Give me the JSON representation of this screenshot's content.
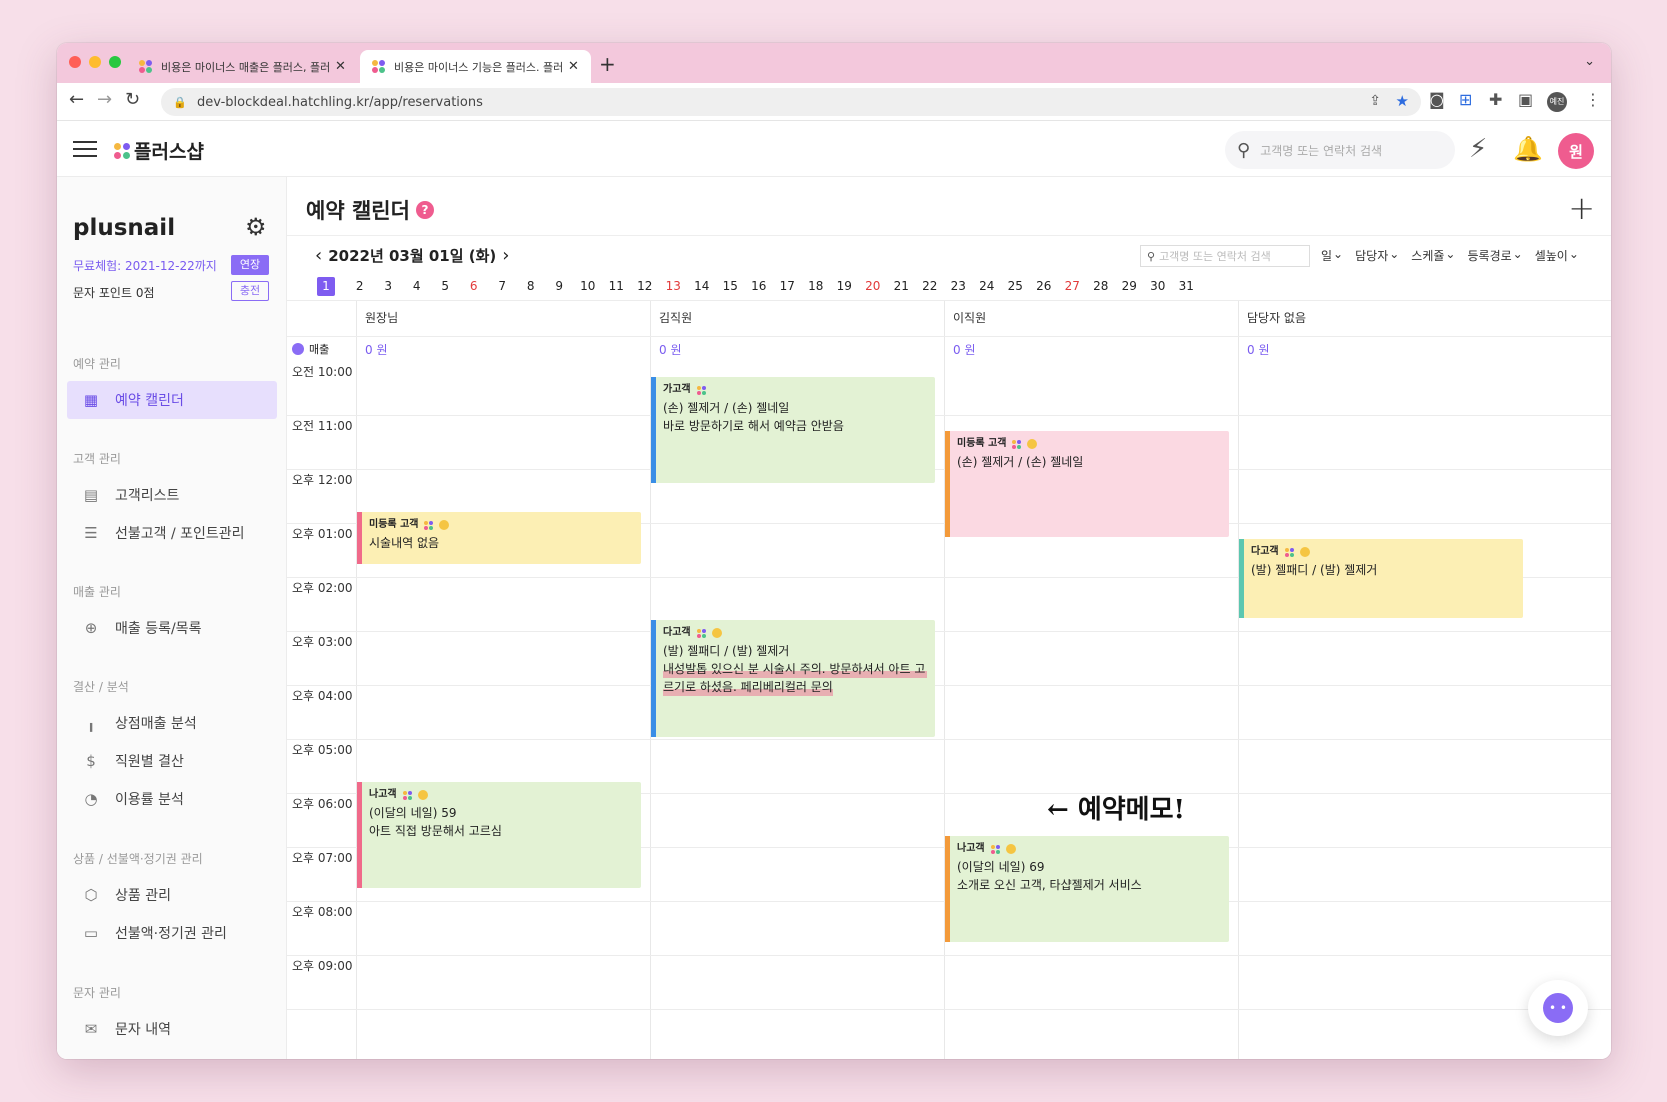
{
  "browser": {
    "tabs": [
      {
        "title": "비용은 마이너스 매출은 플러스, 플러스샵"
      },
      {
        "title": "비용은 마이너스 기능은 플러스. 플러스샵"
      }
    ],
    "url": "dev-blockdeal.hatchling.kr/app/reservations",
    "profile_badge": "예진"
  },
  "header": {
    "logo_text": "플러스샵",
    "search_placeholder": "고객명 또는 연락처 검색",
    "avatar_initial": "원"
  },
  "sidebar": {
    "shop_name": "plusnail",
    "trial_text": "무료체험: 2021-12-22까지",
    "extend_label": "연장",
    "points_text": "문자 포인트 0점",
    "charge_label": "충전",
    "sections": [
      {
        "title": "예약 관리",
        "items": [
          {
            "label": "예약 캘린더",
            "icon": "calendar-icon",
            "active": true
          }
        ]
      },
      {
        "title": "고객 관리",
        "items": [
          {
            "label": "고객리스트",
            "icon": "document-icon"
          },
          {
            "label": "선불고객 / 포인트관리",
            "icon": "database-icon"
          }
        ]
      },
      {
        "title": "매출 관리",
        "items": [
          {
            "label": "매출 등록/목록",
            "icon": "file-plus-icon"
          }
        ]
      },
      {
        "title": "결산 / 분석",
        "items": [
          {
            "label": "상점매출 분석",
            "icon": "bar-chart-icon"
          },
          {
            "label": "직원별 결산",
            "icon": "dollar-icon"
          },
          {
            "label": "이용률 분석",
            "icon": "pie-chart-icon"
          }
        ]
      },
      {
        "title": "상품 / 선불액·정기권 관리",
        "items": [
          {
            "label": "상품 관리",
            "icon": "box-icon"
          },
          {
            "label": "선불액·정기권 관리",
            "icon": "ticket-icon"
          }
        ]
      },
      {
        "title": "문자 관리",
        "items": [
          {
            "label": "문자 내역",
            "icon": "mail-icon"
          }
        ]
      }
    ]
  },
  "page": {
    "title": "예약 캘린더",
    "help": "?",
    "date_label": "2022년 03월 01일 (화)",
    "search_placeholder": "고객명 또는 연락처 검색",
    "filters": [
      "일",
      "담당자",
      "스케쥴",
      "등록경로",
      "셀높이"
    ],
    "days": [
      "1",
      "2",
      "3",
      "4",
      "5",
      "6",
      "7",
      "8",
      "9",
      "10",
      "11",
      "12",
      "13",
      "14",
      "15",
      "16",
      "17",
      "18",
      "19",
      "20",
      "21",
      "22",
      "23",
      "24",
      "25",
      "26",
      "27",
      "28",
      "29",
      "30",
      "31"
    ],
    "selected_day": "1",
    "red_days": [
      "6",
      "13",
      "20",
      "27"
    ],
    "sales_label": "매출",
    "staff": [
      {
        "name": "원장님",
        "sales": "0 원"
      },
      {
        "name": "김직원",
        "sales": "0 원"
      },
      {
        "name": "이직원",
        "sales": "0 원"
      },
      {
        "name": "담당자 없음",
        "sales": "0 원"
      }
    ],
    "times": [
      "오전 10:00",
      "오전 11:00",
      "오후 12:00",
      "오후 01:00",
      "오후 02:00",
      "오후 03:00",
      "오후 04:00",
      "오후 05:00",
      "오후 06:00",
      "오후 07:00",
      "오후 08:00",
      "오후 09:00"
    ]
  },
  "events": [
    {
      "customer": "가고객",
      "service": "(손) 젤제거 / (손) 젤네일",
      "memo": "바로 방문하기로 해서 예약금 안받음",
      "memo2": ""
    },
    {
      "customer": "미등록 고객",
      "service": "(손) 젤제거 / (손) 젤네일",
      "memo": "",
      "memo2": ""
    },
    {
      "customer": "미등록 고객",
      "service": "시술내역 없음",
      "memo": "",
      "memo2": ""
    },
    {
      "customer": "다고객",
      "service": "(발) 젤패디 / (발) 젤제거",
      "memo": "",
      "memo2": ""
    },
    {
      "customer": "다고객",
      "service": "(발) 젤패디 / (발) 젤제거",
      "memo": "내성발톱 있으신 분 시술시 주의. 방문하셔서 아트 고",
      "memo2": "르기로 하셨음. 페리베리컬러 문의"
    },
    {
      "customer": "나고객",
      "service": "(이달의 네일) 59",
      "memo": "아트 직접 방문해서 고르심",
      "memo2": ""
    },
    {
      "customer": "나고객",
      "service": "(이달의 네일) 69",
      "memo": "소개로 오신 고객, 타샵젤제거 서비스",
      "memo2": ""
    }
  ],
  "annotation": {
    "text": "← 예약메모!"
  },
  "colors": {
    "accent": "#7e5cf0",
    "brand_pink": "#ef5c8f",
    "event_green": "#e3f2d4",
    "event_pink": "#fbd9e2",
    "event_yellow": "#fcefb4"
  }
}
